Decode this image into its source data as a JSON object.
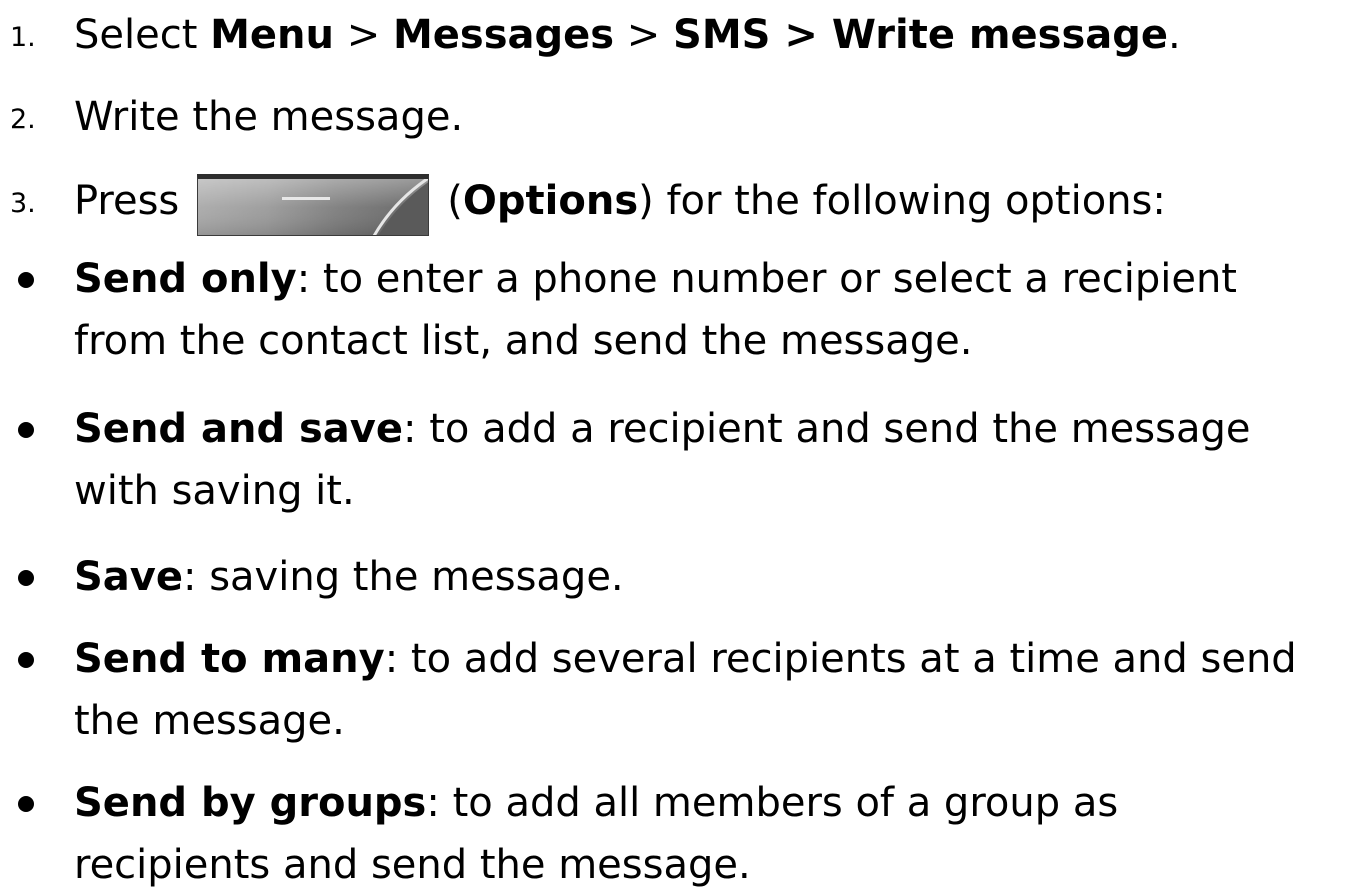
{
  "steps": [
    {
      "number": "1.",
      "parts": [
        "Select ",
        "Menu",
        " > ",
        "Messages",
        " > ",
        "SMS > Write message",
        "."
      ]
    },
    {
      "number": "2.",
      "text": "Write the message."
    },
    {
      "number": "3.",
      "before": "Press",
      "paren_open": "(",
      "key_label": "Options",
      "after": ") for the following options:",
      "key_icon": "left-softkey-icon"
    }
  ],
  "options": [
    {
      "term": "Send only",
      "line1": ": to enter a phone number or select a recipient",
      "line2": "from the contact list, and send the message."
    },
    {
      "term": "Send and save",
      "line1": ": to add a recipient and send the message",
      "line2": "with saving it."
    },
    {
      "term": "Save",
      "line1": ": saving the message.",
      "line2": ""
    },
    {
      "term": "Send to many",
      "line1": ": to add several recipients at a time and send",
      "line2": "the message."
    },
    {
      "term": "Send by groups",
      "line1": ": to add all members of a group as",
      "line2": "recipients and send the message."
    }
  ]
}
